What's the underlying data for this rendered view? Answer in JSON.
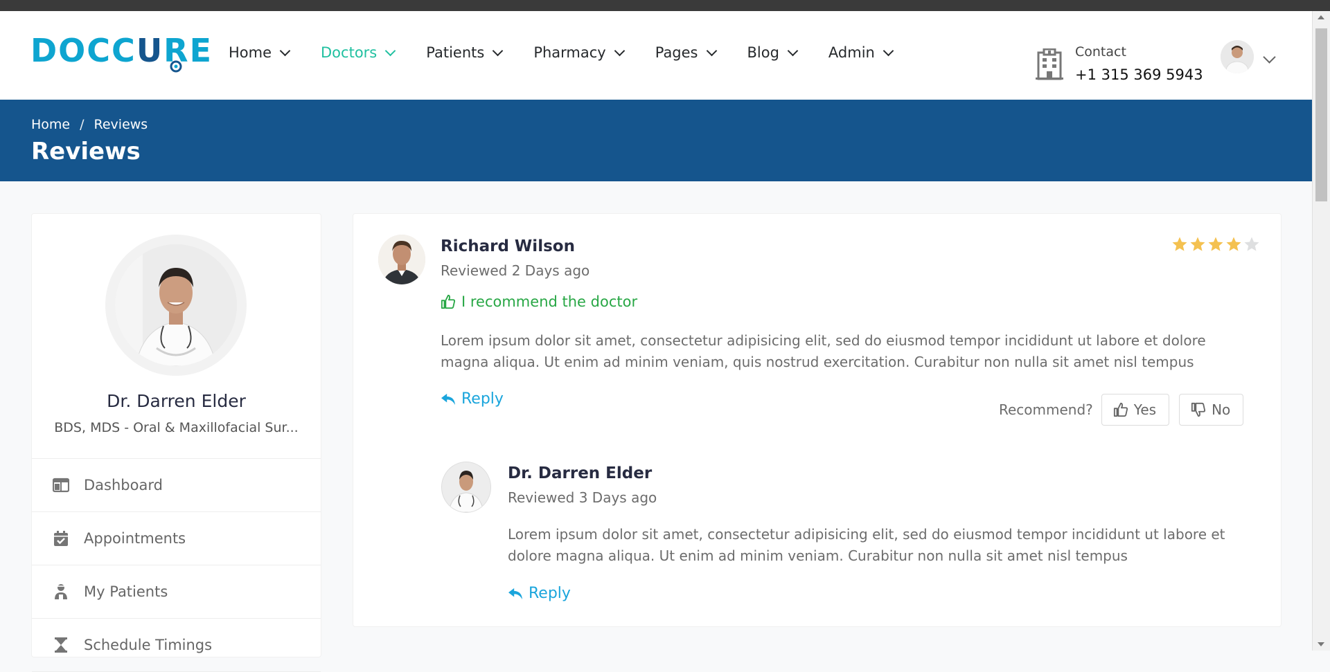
{
  "brand": {
    "logo_text_a": "DOCC",
    "logo_text_u": "U",
    "logo_text_b": "RE"
  },
  "nav": {
    "items": [
      {
        "label": "Home",
        "active": false
      },
      {
        "label": "Doctors",
        "active": true
      },
      {
        "label": "Patients",
        "active": false
      },
      {
        "label": "Pharmacy",
        "active": false
      },
      {
        "label": "Pages",
        "active": false
      },
      {
        "label": "Blog",
        "active": false
      },
      {
        "label": "Admin",
        "active": false
      }
    ]
  },
  "contact": {
    "label": "Contact",
    "phone": "+1 315 369 5943"
  },
  "breadcrumb": {
    "items": [
      "Home",
      "Reviews"
    ],
    "separator": "/",
    "title": "Reviews"
  },
  "profile": {
    "name": "Dr. Darren Elder",
    "degree": "BDS, MDS - Oral & Maxillofacial Sur..."
  },
  "sidebar_menu": [
    {
      "label": "Dashboard",
      "icon": "columns-icon"
    },
    {
      "label": "Appointments",
      "icon": "calendar-check-icon"
    },
    {
      "label": "My Patients",
      "icon": "user-injured-icon"
    },
    {
      "label": "Schedule Timings",
      "icon": "hourglass-icon"
    }
  ],
  "review": {
    "name": "Richard Wilson",
    "date": "Reviewed 2 Days ago",
    "recommend_text": "I recommend the doctor",
    "text": "Lorem ipsum dolor sit amet, consectetur adipisicing elit, sed do eiusmod tempor incididunt ut labore et dolore magna aliqua. Ut enim ad minim veniam, quis nostrud exercitation. Curabitur non nulla sit amet nisl tempus",
    "reply_label": "Reply",
    "rating": 4,
    "rating_max": 5,
    "recommend_question": "Recommend?",
    "yes_label": "Yes",
    "no_label": "No"
  },
  "reply": {
    "name": "Dr. Darren Elder",
    "date": "Reviewed 3 Days ago",
    "text": "Lorem ipsum dolor sit amet, consectetur adipisicing elit, sed do eiusmod tempor incididunt ut labore et dolore magna aliqua. Ut enim ad minim veniam. Curabitur non nulla sit amet nisl tempus",
    "reply_label": "Reply"
  },
  "colors": {
    "primary": "#15558d",
    "accent": "#20c0a0",
    "link": "#1aa5dc",
    "success": "#28a745",
    "star": "#f4c150",
    "star_empty": "#dedfe0"
  }
}
